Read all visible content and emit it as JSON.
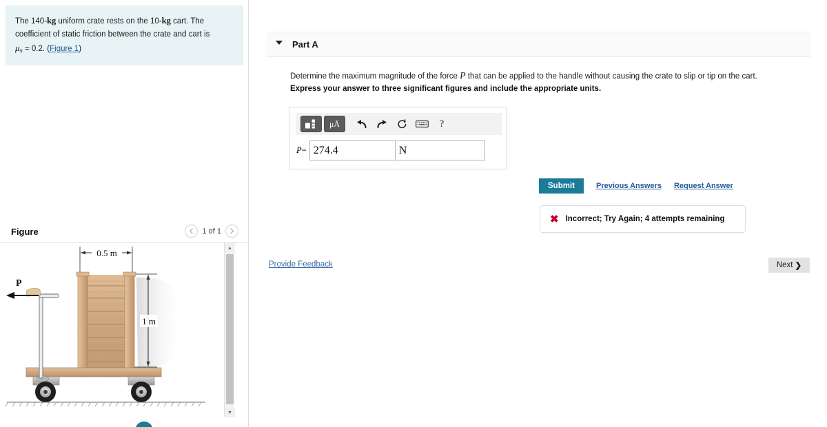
{
  "problem": {
    "text_part1": "The 140-",
    "unit1": "kg",
    "text_part2": " uniform crate rests on the 10-",
    "unit2": "kg",
    "text_part3": " cart. The coefficient of static friction between the crate and cart is ",
    "mu_symbol": "μ",
    "mu_subscript": "s",
    "mu_value": " = 0.2. ",
    "figure_link": "Figure 1"
  },
  "figure_panel": {
    "title": "Figure",
    "counter": "1 of 1",
    "prev_icon": "chevron-left-icon",
    "next_icon": "chevron-right-icon",
    "scroll_up_icon": "▲",
    "scroll_down_icon": "▼",
    "diagram": {
      "force_label": "P",
      "width_dimension": "0.5 m",
      "height_dimension": "1 m"
    }
  },
  "part": {
    "label": "Part A",
    "toggle_icon": "caret-down-icon",
    "question": "Determine the maximum magnitude of the force ",
    "question_var": "P",
    "question_cont": " that can be applied to the handle without causing the crate to slip or tip on the cart.",
    "instruction": "Express your answer to three significant figures and include the appropriate units."
  },
  "answer": {
    "toolbar": {
      "template_icon": "equation-template-icon",
      "units_label": "μÅ",
      "undo_icon": "↰",
      "redo_icon": "↱",
      "reset_icon": "↻",
      "keyboard_icon": "⌨",
      "help_icon": "?"
    },
    "variable_label": "P",
    "equals": "=",
    "value": "274.4",
    "unit": "N",
    "value_placeholder": "",
    "unit_placeholder": ""
  },
  "actions": {
    "submit_label": "Submit",
    "previous_answers_label": "Previous Answers",
    "request_answer_label": "Request Answer"
  },
  "feedback": {
    "status_icon": "✖",
    "message": "Incorrect; Try Again; 4 attempts remaining",
    "provide_feedback_label": "Provide Feedback"
  },
  "footer": {
    "next_label": "Next",
    "next_icon": "❯"
  },
  "colors": {
    "problem_bg": "#e7f3f4",
    "submit_bg": "#1b7b99",
    "link": "#245a9e",
    "error": "#c3002f",
    "input_border": "#9fbcc4"
  }
}
